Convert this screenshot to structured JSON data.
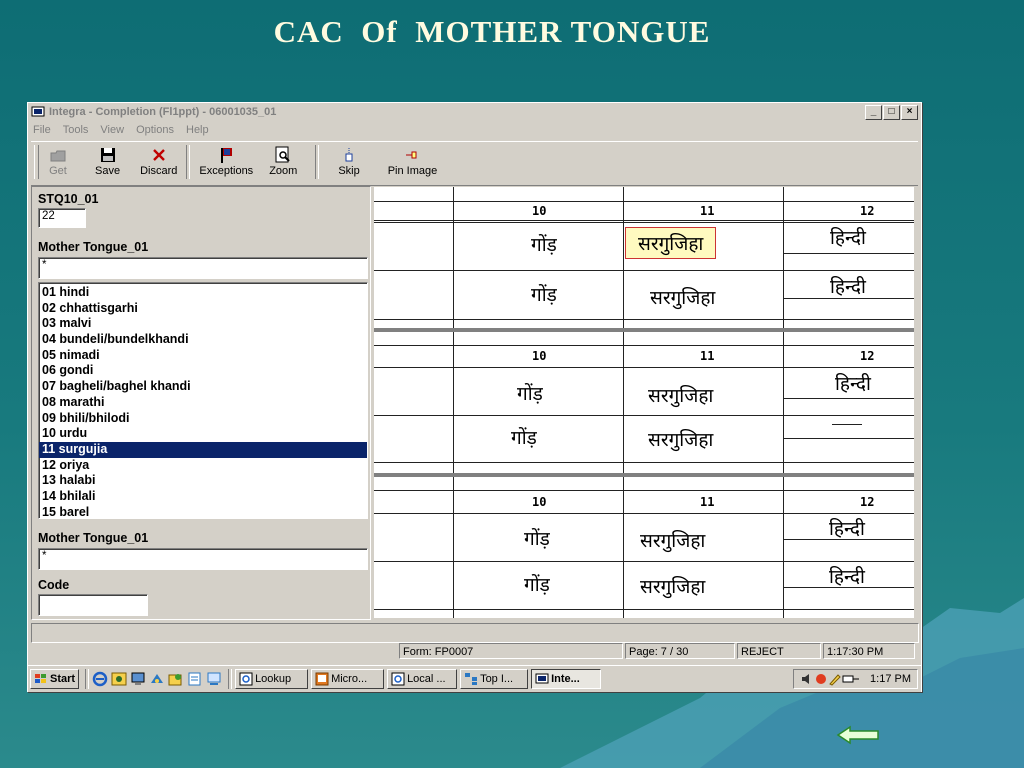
{
  "slide": {
    "title": "CAC  Of  MOTHER TONGUE"
  },
  "window": {
    "title": "Integra - Completion (Fl1ppt) - 06001035_01",
    "controls": {
      "minimize": "_",
      "maximize": "□",
      "close": "×"
    }
  },
  "menu": [
    "File",
    "Tools",
    "View",
    "Options",
    "Help"
  ],
  "toolbar": {
    "get": "Get",
    "save": "Save",
    "discard": "Discard",
    "exceptions": "Exceptions",
    "zoom": "Zoom",
    "skip": "Skip",
    "pin_image": "Pin Image"
  },
  "form": {
    "stq_label": "STQ10_01",
    "stq_value": "22",
    "mother_tongue_label": "Mother Tongue_01",
    "mother_tongue_value": "*",
    "mother_tongue_label2": "Mother Tongue_01",
    "mother_tongue_value2": "*",
    "code_label": "Code",
    "code_value": "",
    "options": [
      "01 hindi",
      "02 chhattisgarhi",
      "03 malvi",
      "04 bundeli/bundelkhandi",
      "05 nimadi",
      "06 gondi",
      "07 bagheli/baghel khandi",
      "08 marathi",
      "09 bhili/bhilodi",
      "10 urdu",
      "11 surgujia",
      "12 oriya",
      "13 halabi",
      "14 bhilali",
      "15 barel"
    ],
    "selected_index": 10
  },
  "scans": [
    {
      "cols": [
        "10",
        "11",
        "12"
      ],
      "row1": [
        "गोंड़",
        "सरगुजिहा",
        "हिन्दी"
      ],
      "row2": [
        "गोंड़",
        "सरगुजिहा",
        "हिन्दी"
      ]
    },
    {
      "cols": [
        "10",
        "11",
        "12"
      ],
      "row1": [
        "गोंड़",
        "सरगुजिहा",
        "हिन्दी"
      ],
      "row2": [
        "गोंड़",
        "सरगुजिहा",
        ""
      ]
    },
    {
      "cols": [
        "10",
        "11",
        "12"
      ],
      "row1": [
        "गोंड़",
        "सरगुजिहा",
        "हिन्दी"
      ],
      "row2": [
        "गोंड़",
        "सरगुजिहा",
        "हिन्दी"
      ]
    }
  ],
  "status": {
    "form": "Form: FP0007",
    "page": "Page: 7 / 30",
    "state": "REJECT",
    "time": "1:17:30 PM"
  },
  "taskbar": {
    "start": "Start",
    "tasks": [
      "Lookup",
      "Micro...",
      "Local ...",
      "Top I...",
      "Inte..."
    ],
    "clock": "1:17 PM"
  },
  "colors": {
    "selection": "#0a246a",
    "highlight": "#fffac0",
    "background": "#0e6d74"
  }
}
